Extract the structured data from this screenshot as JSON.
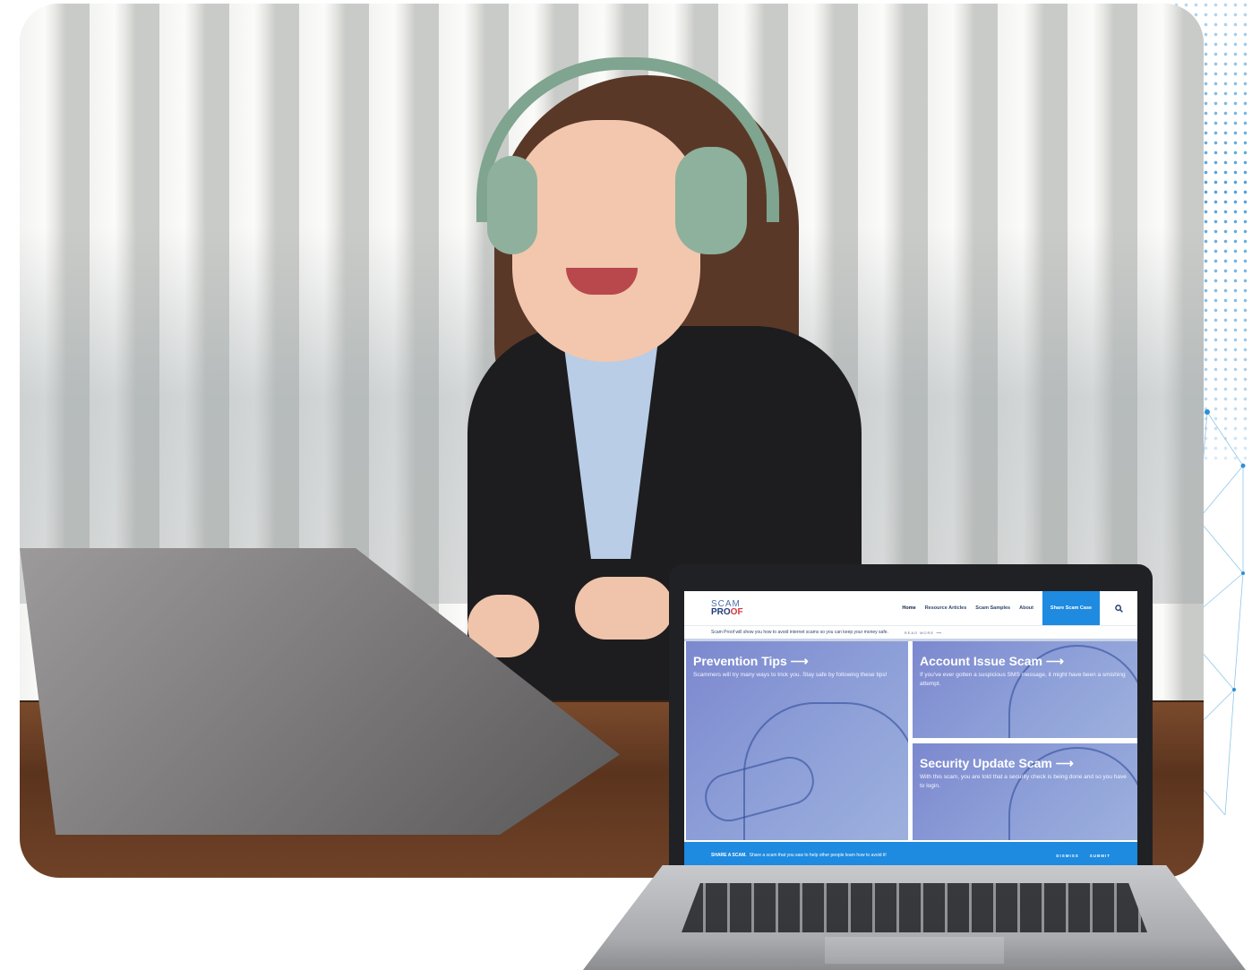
{
  "site": {
    "logo": {
      "line1": "SCAM",
      "line2_pre": "PRO",
      "line2_accent": "OF"
    },
    "nav": {
      "items": [
        "Home",
        "Resource Articles",
        "Scam Samples",
        "About"
      ],
      "cta_label": "Share Scam Case",
      "search_icon": "search-icon"
    },
    "announcement": {
      "text": "Scam Proof will show you how to avoid internet scams so you can keep your money safe.",
      "link": "READ MORE ⟶"
    },
    "cards": [
      {
        "title": "Prevention Tips ⟶",
        "text": "Scammers will try many ways to trick you. Stay safe by following these tips!"
      },
      {
        "title": "Account Issue Scam ⟶",
        "text": "If you've ever gotten a suspicious SMS message, it might have been a smishing attempt."
      },
      {
        "title": "Security Update Scam ⟶",
        "text": "With this scam, you are told that a security check is being done and so you have to login."
      }
    ],
    "share_bar": {
      "lead": "SHARE A SCAM.",
      "text": "Share a scam that you saw to help other people learn how to avoid it!",
      "dismiss": "DISMISS",
      "submit": "SUBMIT"
    }
  },
  "colors": {
    "accent": "#1e8ae0",
    "card_bg": "#7c88cf",
    "logo_accent": "#d9343d",
    "dots": "#2f8fd6"
  }
}
